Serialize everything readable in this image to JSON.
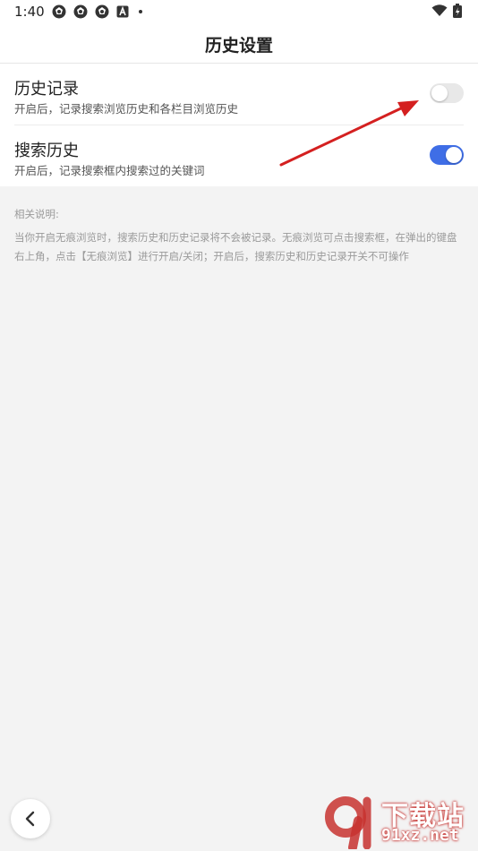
{
  "status_bar": {
    "time": "1:40",
    "notification_icons": [
      "aperture-icon",
      "aperture-icon",
      "aperture-icon",
      "a-box-icon",
      "dot-icon"
    ],
    "right_icons": [
      "wifi-icon",
      "battery-icon"
    ]
  },
  "header": {
    "title": "历史设置"
  },
  "settings": [
    {
      "title": "历史记录",
      "description": "开启后，记录搜索浏览历史和各栏目浏览历史",
      "enabled": false
    },
    {
      "title": "搜索历史",
      "description": "开启后，记录搜索框内搜索过的关键词",
      "enabled": true
    }
  ],
  "notes": {
    "label": "相关说明:",
    "text": "当你开启无痕浏览时，搜索历史和历史记录将不会被记录。无痕浏览可点击搜索框，在弹出的键盘右上角，点击【无痕浏览】进行开启/关闭；开启后，搜索历史和历史记录开关不可操作"
  },
  "colors": {
    "accent": "#3f6ee6",
    "toggle_off": "#e8e8e8",
    "annotation_arrow": "#d42020",
    "watermark": "#c7322f"
  },
  "watermark": {
    "line1": "下载站",
    "line2": "91xz.net"
  }
}
